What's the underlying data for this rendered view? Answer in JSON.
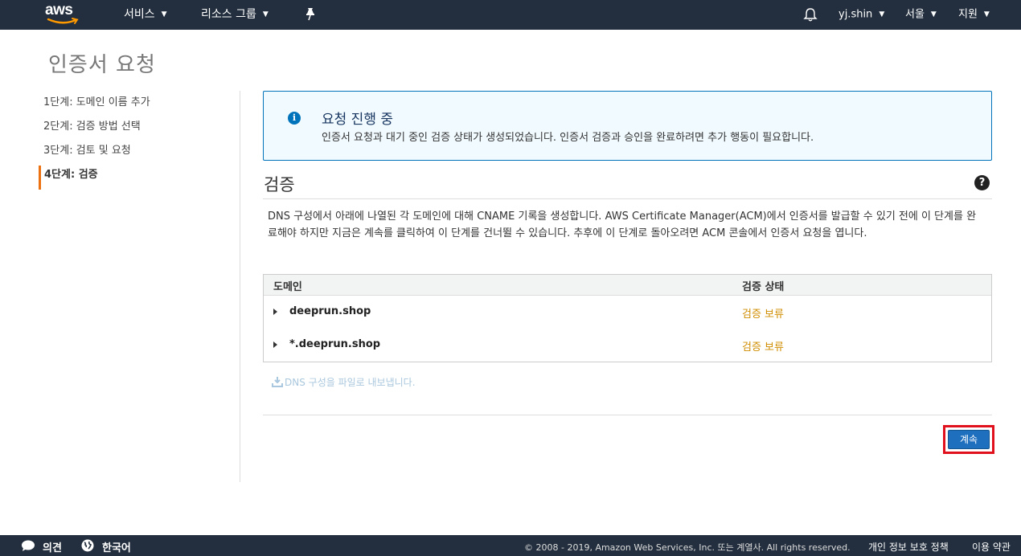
{
  "nav": {
    "logo_text": "aws",
    "services": "서비스",
    "resource_groups": "리소스 그룹",
    "user": "yj.shin",
    "region": "서울",
    "support": "지원"
  },
  "page": {
    "title": "인증서 요청"
  },
  "steps": [
    {
      "label": "1단계: 도메인 이름 추가",
      "active": false
    },
    {
      "label": "2단계: 검증 방법 선택",
      "active": false
    },
    {
      "label": "3단계: 검토 및 요청",
      "active": false
    },
    {
      "label": "4단계: 검증",
      "active": true
    }
  ],
  "info": {
    "title": "요청 진행 중",
    "message": "인증서 요청과 대기 중인 검증 상태가 생성되었습니다. 인증서 검증과 승인을 완료하려면 추가 행동이 필요합니다."
  },
  "validation": {
    "title": "검증",
    "description": "DNS 구성에서 아래에 나열된 각 도메인에 대해 CNAME 기록을 생성합니다. AWS Certificate Manager(ACM)에서 인증서를 발급할 수 있기 전에 이 단계를 완료해야 하지만 지금은 계속를 클릭하여 이 단계를 건너뛸 수 있습니다. 추후에 이 단계로 돌아오려면 ACM 콘솔에서 인증서 요청을 엽니다.",
    "columns": [
      "도메인",
      "검증 상태"
    ],
    "rows": [
      {
        "domain": "deeprun.shop",
        "status": "검증 보류"
      },
      {
        "domain": "*.deeprun.shop",
        "status": "검증 보류"
      }
    ],
    "export_link": "DNS 구성을 파일로 내보냅니다.",
    "continue_button": "계속"
  },
  "footer": {
    "feedback": "의견",
    "language": "한국어",
    "copyright": "© 2008 - 2019, Amazon Web Services, Inc. 또는 계열사. All rights reserved.",
    "privacy": "개인 정보 보호 정책",
    "terms": "이용 약관"
  },
  "colors": {
    "nav_bg": "#232f3e",
    "accent": "#ec7211",
    "info_border": "#0073bb",
    "pending": "#d08d00",
    "button": "#1f6fbf",
    "highlight": "#e0101c"
  }
}
